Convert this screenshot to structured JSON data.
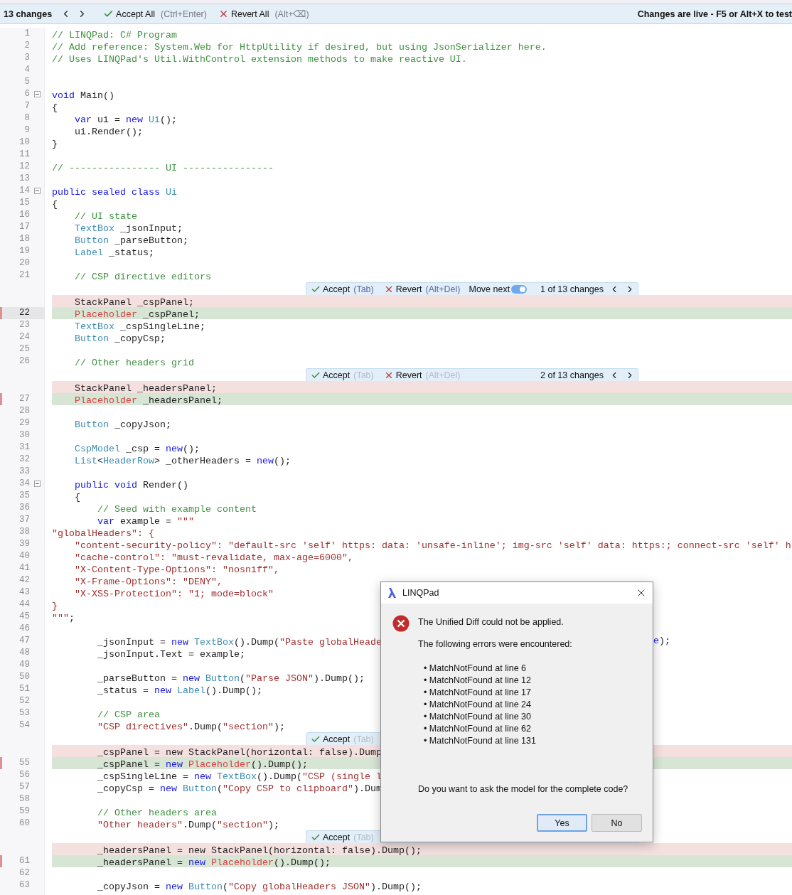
{
  "top_bar": {
    "count": "13 changes",
    "accept_all": {
      "label": "Accept All",
      "hint": "(Ctrl+Enter)"
    },
    "revert_all": {
      "label": "Revert All",
      "hint": "(Alt+⌫)"
    },
    "status": "Changes are live - F5 or Alt+X to test"
  },
  "rows": [
    {
      "kind": "line",
      "number": "1",
      "segments": [
        {
          "kind": "comment",
          "text": "// LINQPad: C# Program"
        }
      ]
    },
    {
      "kind": "line",
      "number": "2",
      "segments": [
        {
          "kind": "comment",
          "text": "// Add reference: System.Web for HttpUtility if desired, but using JsonSerializer here."
        }
      ]
    },
    {
      "kind": "line",
      "number": "3",
      "segments": [
        {
          "kind": "comment",
          "text": "// Uses LINQPad's Util.WithControl extension methods to make reactive UI."
        }
      ]
    },
    {
      "kind": "line",
      "number": "4"
    },
    {
      "kind": "line",
      "number": "5"
    },
    {
      "kind": "line",
      "number": "6",
      "foldable": true,
      "segments": [
        {
          "kind": "keyword",
          "text": "void"
        },
        {
          "kind": "plain",
          "text": " Main()"
        }
      ]
    },
    {
      "kind": "line",
      "number": "7",
      "segments": [
        {
          "kind": "plain",
          "text": "{"
        }
      ]
    },
    {
      "kind": "line",
      "number": "8",
      "segments": [
        {
          "kind": "keyword",
          "text": "    var"
        },
        {
          "kind": "plain",
          "text": " ui = "
        },
        {
          "kind": "keyword",
          "text": "new"
        },
        {
          "kind": "type",
          "text": " Ui"
        },
        {
          "kind": "plain",
          "text": "();"
        }
      ]
    },
    {
      "kind": "line",
      "number": "9",
      "segments": [
        {
          "kind": "plain",
          "text": "    ui.Render();"
        }
      ]
    },
    {
      "kind": "line",
      "number": "10",
      "segments": [
        {
          "kind": "plain",
          "text": "}"
        }
      ]
    },
    {
      "kind": "line",
      "number": "11"
    },
    {
      "kind": "line",
      "number": "12",
      "segments": [
        {
          "kind": "comment",
          "text": "// ---------------- UI ----------------"
        }
      ]
    },
    {
      "kind": "line",
      "number": "13"
    },
    {
      "kind": "line",
      "number": "14",
      "foldable": true,
      "segments": [
        {
          "kind": "keyword",
          "text": "public sealed class"
        },
        {
          "kind": "type",
          "text": " Ui"
        }
      ]
    },
    {
      "kind": "line",
      "number": "15",
      "segments": [
        {
          "kind": "plain",
          "text": "{"
        }
      ]
    },
    {
      "kind": "line",
      "number": "16",
      "segments": [
        {
          "kind": "comment",
          "text": "    // UI state"
        }
      ]
    },
    {
      "kind": "line",
      "number": "17",
      "segments": [
        {
          "kind": "type",
          "text": "    TextBox"
        },
        {
          "kind": "plain",
          "text": " _jsonInput;"
        }
      ]
    },
    {
      "kind": "line",
      "number": "18",
      "segments": [
        {
          "kind": "type",
          "text": "    Button"
        },
        {
          "kind": "plain",
          "text": " _parseButton;"
        }
      ]
    },
    {
      "kind": "line",
      "number": "19",
      "segments": [
        {
          "kind": "type",
          "text": "    Label"
        },
        {
          "kind": "plain",
          "text": " _status;"
        }
      ]
    },
    {
      "kind": "line",
      "number": "20"
    },
    {
      "kind": "line",
      "number": "21",
      "segments": [
        {
          "kind": "comment",
          "text": "    // CSP directive editors"
        }
      ]
    },
    {
      "kind": "bar",
      "active": true,
      "accept": {
        "label": "Accept",
        "hint": "(Tab)"
      },
      "revert": {
        "label": "Revert",
        "hint": "(Alt+Del)"
      },
      "move_next": {
        "label": "Move next",
        "on": true
      },
      "counter": "1 of 13 changes"
    },
    {
      "kind": "removed",
      "segments": [
        {
          "kind": "plain",
          "text": "    StackPanel _cspPanel;"
        }
      ]
    },
    {
      "kind": "added",
      "number": "22",
      "current": true,
      "segments": [
        {
          "kind": "new-type",
          "text": "    Placeholder"
        },
        {
          "kind": "plain",
          "text": " _cspPanel;"
        }
      ]
    },
    {
      "kind": "line",
      "number": "23",
      "segments": [
        {
          "kind": "type",
          "text": "    TextBox"
        },
        {
          "kind": "plain",
          "text": " _cspSingleLine;"
        }
      ]
    },
    {
      "kind": "line",
      "number": "24",
      "segments": [
        {
          "kind": "type",
          "text": "    Button"
        },
        {
          "kind": "plain",
          "text": " _copyCsp;"
        }
      ]
    },
    {
      "kind": "line",
      "number": "25"
    },
    {
      "kind": "line",
      "number": "26",
      "segments": [
        {
          "kind": "comment",
          "text": "    // Other headers grid"
        }
      ]
    },
    {
      "kind": "bar",
      "active": false,
      "accept": {
        "label": "Accept",
        "hint": "(Tab)"
      },
      "revert": {
        "label": "Revert",
        "hint": "(Alt+Del)"
      },
      "counter": "2 of 13 changes"
    },
    {
      "kind": "removed",
      "segments": [
        {
          "kind": "plain",
          "text": "    StackPanel _headersPanel;"
        }
      ]
    },
    {
      "kind": "added",
      "number": "27",
      "current": false,
      "segments": [
        {
          "kind": "new-type",
          "text": "    Placeholder"
        },
        {
          "kind": "plain",
          "text": " _headersPanel;"
        }
      ]
    },
    {
      "kind": "line",
      "number": "28"
    },
    {
      "kind": "line",
      "number": "29",
      "segments": [
        {
          "kind": "type",
          "text": "    Button"
        },
        {
          "kind": "plain",
          "text": " _copyJson;"
        }
      ]
    },
    {
      "kind": "line",
      "number": "30"
    },
    {
      "kind": "line",
      "number": "31",
      "segments": [
        {
          "kind": "type",
          "text": "    CspModel"
        },
        {
          "kind": "plain",
          "text": " _csp = "
        },
        {
          "kind": "keyword",
          "text": "new"
        },
        {
          "kind": "plain",
          "text": "();"
        }
      ]
    },
    {
      "kind": "line",
      "number": "32",
      "segments": [
        {
          "kind": "type",
          "text": "    List"
        },
        {
          "kind": "plain",
          "text": "<"
        },
        {
          "kind": "type",
          "text": "HeaderRow"
        },
        {
          "kind": "plain",
          "text": "> _otherHeaders = "
        },
        {
          "kind": "keyword",
          "text": "new"
        },
        {
          "kind": "plain",
          "text": "();"
        }
      ]
    },
    {
      "kind": "line",
      "number": "33"
    },
    {
      "kind": "line",
      "number": "34",
      "foldable": true,
      "segments": [
        {
          "kind": "keyword",
          "text": "    public void"
        },
        {
          "kind": "plain",
          "text": " Render()"
        }
      ]
    },
    {
      "kind": "line",
      "number": "35",
      "segments": [
        {
          "kind": "plain",
          "text": "    {"
        }
      ]
    },
    {
      "kind": "line",
      "number": "36",
      "segments": [
        {
          "kind": "comment",
          "text": "        // Seed with example content"
        }
      ]
    },
    {
      "kind": "line",
      "number": "37",
      "segments": [
        {
          "kind": "keyword",
          "text": "        var"
        },
        {
          "kind": "plain",
          "text": " example = "
        },
        {
          "kind": "string",
          "text": "\"\"\""
        }
      ]
    },
    {
      "kind": "line",
      "number": "38",
      "segments": [
        {
          "kind": "string",
          "text": "\"globalHeaders\": {"
        }
      ]
    },
    {
      "kind": "line",
      "number": "39",
      "segments": [
        {
          "kind": "string",
          "text": "    \"content-security-policy\": \"default-src 'self' https: data: 'unsafe-inline'; img-src 'self' data: https:; connect-src 'self' h"
        }
      ]
    },
    {
      "kind": "line",
      "number": "40",
      "segments": [
        {
          "kind": "string",
          "text": "    \"cache-control\": \"must-revalidate, max-age=6000\","
        }
      ]
    },
    {
      "kind": "line",
      "number": "41",
      "segments": [
        {
          "kind": "string",
          "text": "    \"X-Content-Type-Options\": \"nosniff\","
        }
      ]
    },
    {
      "kind": "line",
      "number": "42",
      "segments": [
        {
          "kind": "string",
          "text": "    \"X-Frame-Options\": \"DENY\","
        }
      ]
    },
    {
      "kind": "line",
      "number": "43",
      "segments": [
        {
          "kind": "string",
          "text": "    \"X-XSS-Protection\": \"1; mode=block\""
        }
      ]
    },
    {
      "kind": "line",
      "number": "44",
      "segments": [
        {
          "kind": "string",
          "text": "}"
        }
      ]
    },
    {
      "kind": "line",
      "number": "45",
      "segments": [
        {
          "kind": "string",
          "text": "\"\"\""
        },
        {
          "kind": "plain",
          "text": ";"
        }
      ]
    },
    {
      "kind": "line",
      "number": "46"
    },
    {
      "kind": "line",
      "number": "47",
      "segments": [
        {
          "kind": "plain",
          "text": "        _jsonInput = "
        },
        {
          "kind": "keyword",
          "text": "new"
        },
        {
          "kind": "type",
          "text": " TextBox"
        },
        {
          "kind": "plain",
          "text": "().Dump("
        },
        {
          "kind": "string",
          "text": "\"Paste globalHeade"
        }
      ],
      "tail": [
        {
          "kind": "keyword",
          "text": "e"
        },
        {
          "kind": "plain",
          "text": ");"
        }
      ]
    },
    {
      "kind": "line",
      "number": "48",
      "segments": [
        {
          "kind": "plain",
          "text": "        _jsonInput.Text = example;"
        }
      ]
    },
    {
      "kind": "line",
      "number": "49"
    },
    {
      "kind": "line",
      "number": "50",
      "segments": [
        {
          "kind": "plain",
          "text": "        _parseButton = "
        },
        {
          "kind": "keyword",
          "text": "new"
        },
        {
          "kind": "type",
          "text": " Button"
        },
        {
          "kind": "plain",
          "text": "("
        },
        {
          "kind": "string",
          "text": "\"Parse JSON\""
        },
        {
          "kind": "plain",
          "text": ").Dump();"
        }
      ]
    },
    {
      "kind": "line",
      "number": "51",
      "segments": [
        {
          "kind": "plain",
          "text": "        _status = "
        },
        {
          "kind": "keyword",
          "text": "new"
        },
        {
          "kind": "type",
          "text": " Label"
        },
        {
          "kind": "plain",
          "text": "().Dump();"
        }
      ]
    },
    {
      "kind": "line",
      "number": "52"
    },
    {
      "kind": "line",
      "number": "53",
      "segments": [
        {
          "kind": "comment",
          "text": "        // CSP area"
        }
      ]
    },
    {
      "kind": "line",
      "number": "54",
      "segments": [
        {
          "kind": "string",
          "text": "        \"CSP directives\""
        },
        {
          "kind": "plain",
          "text": ".Dump("
        },
        {
          "kind": "string",
          "text": "\"section\""
        },
        {
          "kind": "plain",
          "text": ");"
        }
      ]
    },
    {
      "kind": "bar",
      "active": false,
      "accept": {
        "label": "Accept",
        "hint": "(Tab)"
      }
    },
    {
      "kind": "removed",
      "segments": [
        {
          "kind": "plain",
          "text": "        _cspPanel = new StackPanel(horizontal: false).Dump"
        }
      ]
    },
    {
      "kind": "added",
      "number": "55",
      "current": false,
      "segments": [
        {
          "kind": "plain",
          "text": "        _cspPanel = "
        },
        {
          "kind": "keyword",
          "text": "new"
        },
        {
          "kind": "new-type",
          "text": " Placeholder"
        },
        {
          "kind": "plain",
          "text": "().Dump();"
        }
      ]
    },
    {
      "kind": "line",
      "number": "56",
      "segments": [
        {
          "kind": "plain",
          "text": "        _cspSingleLine = "
        },
        {
          "kind": "keyword",
          "text": "new"
        },
        {
          "kind": "type",
          "text": " TextBox"
        },
        {
          "kind": "plain",
          "text": "().Dump("
        },
        {
          "kind": "string",
          "text": "\"CSP (single l"
        }
      ]
    },
    {
      "kind": "line",
      "number": "57",
      "segments": [
        {
          "kind": "plain",
          "text": "        _copyCsp = "
        },
        {
          "kind": "keyword",
          "text": "new"
        },
        {
          "kind": "type",
          "text": " Button"
        },
        {
          "kind": "plain",
          "text": "("
        },
        {
          "kind": "string",
          "text": "\"Copy CSP to clipboard\""
        },
        {
          "kind": "plain",
          "text": ").Dum"
        }
      ]
    },
    {
      "kind": "line",
      "number": "58"
    },
    {
      "kind": "line",
      "number": "59",
      "segments": [
        {
          "kind": "comment",
          "text": "        // Other headers area"
        }
      ]
    },
    {
      "kind": "line",
      "number": "60",
      "segments": [
        {
          "kind": "string",
          "text": "        \"Other headers\""
        },
        {
          "kind": "plain",
          "text": ".Dump("
        },
        {
          "kind": "string",
          "text": "\"section\""
        },
        {
          "kind": "plain",
          "text": ");"
        }
      ]
    },
    {
      "kind": "bar",
      "active": false,
      "accept": {
        "label": "Accept",
        "hint": "(Tab)"
      }
    },
    {
      "kind": "removed",
      "segments": [
        {
          "kind": "plain",
          "text": "        _headersPanel = new StackPanel(horizontal: false).Dump();"
        }
      ]
    },
    {
      "kind": "added",
      "number": "61",
      "current": false,
      "segments": [
        {
          "kind": "plain",
          "text": "        _headersPanel = "
        },
        {
          "kind": "keyword",
          "text": "new"
        },
        {
          "kind": "new-type",
          "text": " Placeholder"
        },
        {
          "kind": "plain",
          "text": "().Dump();"
        }
      ]
    },
    {
      "kind": "line",
      "number": "62"
    },
    {
      "kind": "line",
      "number": "63",
      "segments": [
        {
          "kind": "plain",
          "text": "        _copyJson = "
        },
        {
          "kind": "keyword",
          "text": "new"
        },
        {
          "kind": "type",
          "text": " Button"
        },
        {
          "kind": "plain",
          "text": "("
        },
        {
          "kind": "string",
          "text": "\"Copy globalHeaders JSON\""
        },
        {
          "kind": "plain",
          "text": ").Dump();"
        }
      ]
    }
  ],
  "dialog": {
    "title": "LINQPad",
    "message": "The Unified Diff could not be applied.",
    "errors_heading": "The following errors were encountered:",
    "errors": [
      "• MatchNotFound at line 6",
      "• MatchNotFound at line 12",
      "• MatchNotFound at line 17",
      "• MatchNotFound at line 24",
      "• MatchNotFound at line 30",
      "• MatchNotFound at line 62",
      "• MatchNotFound at line 131"
    ],
    "question": "Do you want to ask the model for the complete code?",
    "buttons": [
      {
        "label": "Yes",
        "selected": true
      },
      {
        "label": "No",
        "selected": false
      }
    ]
  }
}
